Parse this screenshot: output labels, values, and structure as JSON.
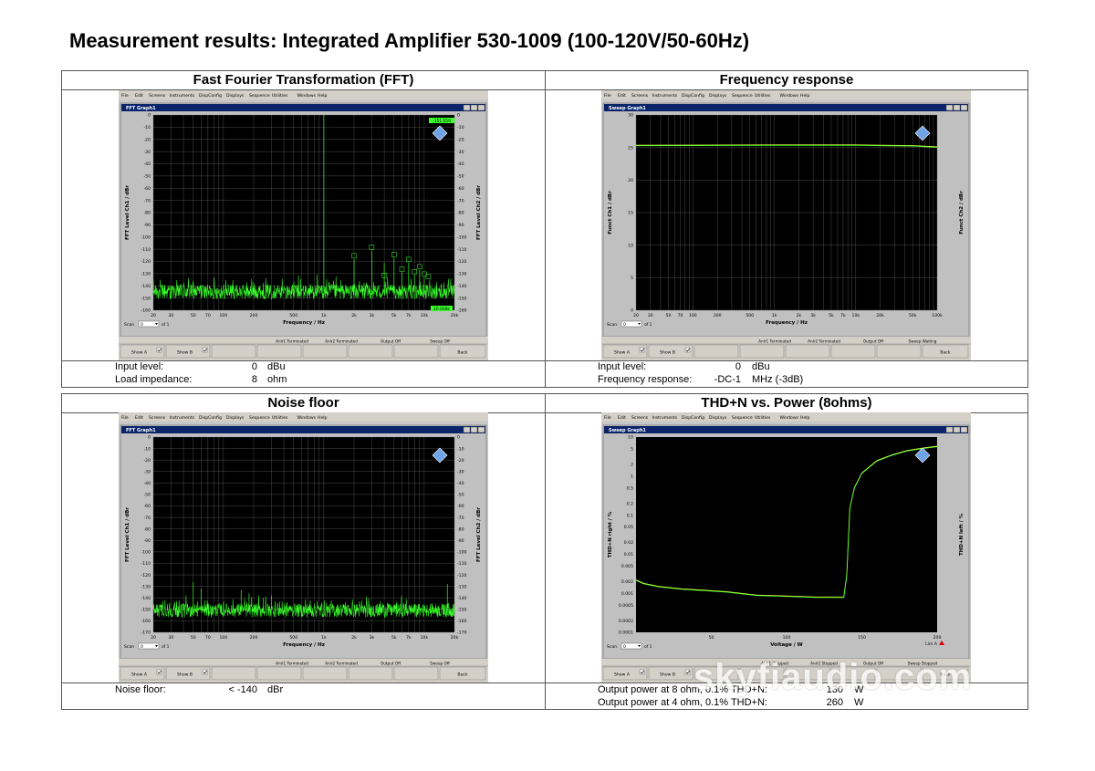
{
  "page": {
    "title": "Measurement results: Integrated Amplifier 530-1009 (100-120V/50-60Hz)",
    "watermark": "skyfiaudio.com"
  },
  "menu": [
    "File",
    "Edit",
    "Screens",
    "Instruments",
    "DispConfig",
    "Displays",
    "Sequence",
    "Utilities",
    "Windows",
    "Help"
  ],
  "common": {
    "scan_label": "Scan",
    "scan_value": "0",
    "scan_of": "of 1",
    "show_a": "Show A",
    "show_b": "Show B",
    "back": "Back"
  },
  "fft": {
    "heading": "Fast Fourier Transformation (FFT)",
    "window_title": "FFT Graph1",
    "status": [
      "Anlr1 Terminated",
      "Anlr2 Terminated",
      "Output Off",
      "Sweep Off"
    ],
    "marker_top": "-151.059",
    "marker_bottom": "20.000k",
    "info": [
      {
        "label": "Input level:",
        "value": "0",
        "unit": "dBu"
      },
      {
        "label": "Load impedance:",
        "value": "8",
        "unit": "ohm"
      }
    ]
  },
  "freq": {
    "heading": "Frequency response",
    "window_title": "Sweep Graph1",
    "status": [
      "Anlr1 Terminated",
      "Anlr2 Terminated",
      "Output Off",
      "Sweep Waiting"
    ],
    "info": [
      {
        "label": "Input level:",
        "value": "0",
        "unit": "dBu"
      },
      {
        "label": "Frequency response:",
        "value": "-DC-1",
        "unit": "MHz (-3dB)"
      }
    ]
  },
  "noise": {
    "heading": "Noise floor",
    "window_title": "FFT Graph1",
    "status": [
      "Anlr1 Terminated",
      "Anlr2 Terminated",
      "Output Off",
      "Sweep Off"
    ],
    "info": [
      {
        "label": "Noise floor:",
        "value": "< -140",
        "unit": "dBr"
      }
    ]
  },
  "thd": {
    "heading": "THD+N vs. Power (8ohms)",
    "window_title": "Sweep Graph1",
    "status": [
      "Anlr1 Stopped",
      "Anlr2 Stopped",
      "Output Off",
      "Sweep Stopped"
    ],
    "lim_label": "Lim A",
    "info": [
      {
        "label": "Output power at 8 ohm, 0.1% THD+N:",
        "value": "130",
        "unit": "W"
      },
      {
        "label": "Output power at 4 ohm, 0.1% THD+N:",
        "value": "260",
        "unit": "W"
      }
    ]
  },
  "chart_data": [
    {
      "type": "line",
      "id": "fft",
      "xscale": "log",
      "xlim": [
        20,
        20000
      ],
      "ylim": [
        -160,
        0
      ],
      "xlabel": "Frequency / Hz",
      "ylabel": "FFT Level Ch1 / dBr",
      "ylabel2": "FFT Level Ch2 / dBr",
      "xticks": [
        20,
        30,
        50,
        70,
        100,
        200,
        500,
        1000,
        2000,
        3000,
        5000,
        7000,
        10000,
        20000
      ],
      "xtick_labels": [
        "20",
        "30",
        "50",
        "70",
        "100",
        "200",
        "500",
        "1k",
        "2k",
        "3k",
        "5k",
        "7k",
        "10k",
        "20k"
      ],
      "yticks": [
        0,
        -10,
        -20,
        -30,
        -40,
        -50,
        -60,
        -70,
        -80,
        -90,
        -100,
        -110,
        -120,
        -130,
        -140,
        -150,
        -160
      ],
      "ytick_labels": [
        "0",
        "-10",
        "-20",
        "-30",
        "-40",
        "-50",
        "-60",
        "-70",
        "-80",
        "-90",
        "-100",
        "-110",
        "-120",
        "-130",
        "-140",
        "-150",
        "-160"
      ],
      "grid": true,
      "noise": {
        "y": -145,
        "spread": 6
      },
      "peaks": [
        {
          "x": 1000,
          "y": 0
        },
        {
          "x": 50,
          "y": -138
        },
        {
          "x": 60,
          "y": -140
        },
        {
          "x": 200,
          "y": -137
        },
        {
          "x": 500,
          "y": -139
        },
        {
          "x": 2000,
          "y": -118
        },
        {
          "x": 3000,
          "y": -111
        },
        {
          "x": 4000,
          "y": -121
        },
        {
          "x": 5000,
          "y": -117
        },
        {
          "x": 6000,
          "y": -129
        },
        {
          "x": 7000,
          "y": -121
        },
        {
          "x": 8000,
          "y": -131
        },
        {
          "x": 9000,
          "y": -127
        },
        {
          "x": 10000,
          "y": -133
        }
      ],
      "markers": [
        {
          "x": 2000,
          "y": -118
        },
        {
          "x": 3000,
          "y": -111
        },
        {
          "x": 4000,
          "y": -134
        },
        {
          "x": 5000,
          "y": -117
        },
        {
          "x": 6000,
          "y": -129
        },
        {
          "x": 7000,
          "y": -121
        },
        {
          "x": 8000,
          "y": -131
        },
        {
          "x": 9000,
          "y": -127
        },
        {
          "x": 10000,
          "y": -133
        },
        {
          "x": 11000,
          "y": -135
        }
      ]
    },
    {
      "type": "line",
      "id": "freq",
      "xscale": "log",
      "xlim": [
        20,
        100000
      ],
      "ylim": [
        0,
        30
      ],
      "xlabel": "Frequency / Hz",
      "ylabel": "Funct Ch1 / dBr",
      "ylabel2": "Funct Ch2 / dBr",
      "xticks": [
        20,
        30,
        50,
        70,
        100,
        200,
        500,
        1000,
        2000,
        3000,
        5000,
        7000,
        10000,
        20000,
        50000,
        100000
      ],
      "xtick_labels": [
        "20",
        "30",
        "50",
        "70",
        "100",
        "200",
        "500",
        "1k",
        "2k",
        "3k",
        "5k",
        "7k",
        "10k",
        "20k",
        "50k",
        "100k"
      ],
      "yticks": [
        0,
        5,
        10,
        15,
        20,
        25,
        30
      ],
      "ytick_labels": [
        "0",
        "5",
        "10",
        "15",
        "20",
        "25",
        "30"
      ],
      "grid": true,
      "series": [
        {
          "x": [
            20,
            1000,
            10000,
            20000,
            50000,
            100000
          ],
          "y": [
            25.35,
            25.4,
            25.4,
            25.35,
            25.3,
            25.1
          ]
        }
      ]
    },
    {
      "type": "line",
      "id": "noise",
      "xscale": "log",
      "xlim": [
        20,
        20000
      ],
      "ylim": [
        -170,
        0
      ],
      "xlabel": "Frequency / Hz",
      "ylabel": "FFT Level Ch1 / dBr",
      "ylabel2": "FFT Level Ch2 / dBr",
      "xticks": [
        20,
        30,
        50,
        70,
        100,
        200,
        500,
        1000,
        2000,
        3000,
        5000,
        7000,
        10000,
        20000
      ],
      "xtick_labels": [
        "20",
        "30",
        "50",
        "70",
        "100",
        "200",
        "500",
        "1k",
        "2k",
        "3k",
        "5k",
        "7k",
        "10k",
        "20k"
      ],
      "yticks": [
        0,
        -10,
        -20,
        -30,
        -40,
        -50,
        -60,
        -70,
        -80,
        -90,
        -100,
        -110,
        -120,
        -130,
        -140,
        -150,
        -160,
        -170
      ],
      "ytick_labels": [
        "0",
        "-10",
        "-20",
        "-30",
        "-40",
        "-50",
        "-60",
        "-70",
        "-80",
        "-90",
        "-100",
        "-110",
        "-120",
        "-130",
        "-140",
        "-150",
        "-160",
        "-170"
      ],
      "grid": true,
      "noise": {
        "y": -151,
        "spread": 6
      },
      "peaks": [
        {
          "x": 50,
          "y": -126
        },
        {
          "x": 60,
          "y": -132
        },
        {
          "x": 150,
          "y": -133
        },
        {
          "x": 180,
          "y": -136
        },
        {
          "x": 250,
          "y": -140
        },
        {
          "x": 300,
          "y": -138
        },
        {
          "x": 17000,
          "y": -128
        }
      ]
    },
    {
      "type": "line",
      "id": "thd",
      "xscale": "linear",
      "yscale": "log",
      "xlim": [
        0,
        200
      ],
      "ylim": [
        0.0001,
        10
      ],
      "xlabel": "Voltage / W",
      "ylabel": "THD+N right / %",
      "ylabel2": "THD+N left / %",
      "xticks": [
        50,
        100,
        150,
        200
      ],
      "xtick_labels": [
        "50",
        "100",
        "150",
        "200"
      ],
      "yticks": [
        10,
        5,
        2,
        1,
        0.5,
        0.2,
        0.1,
        0.05,
        0.02,
        0.01,
        0.005,
        0.002,
        0.001,
        0.0005,
        0.0002,
        0.0001
      ],
      "ytick_labels": [
        "10",
        "5",
        "2",
        "1",
        "0.5",
        "0.2",
        "0.1",
        "0.05",
        "0.02",
        "0.01",
        "0.005",
        "0.002",
        "0.001",
        "0.0005",
        "0.0002",
        "0.0001"
      ],
      "grid": false,
      "series": [
        {
          "x": [
            0,
            5,
            15,
            30,
            45,
            60,
            80,
            100,
            120,
            135,
            138,
            140,
            142,
            145,
            150,
            160,
            170,
            180,
            190,
            200
          ],
          "y": [
            0.0022,
            0.0018,
            0.0015,
            0.0013,
            0.0012,
            0.0011,
            0.0009,
            0.00085,
            0.0008,
            0.0008,
            0.0008,
            0.003,
            0.15,
            0.5,
            1.2,
            2.5,
            3.5,
            4.5,
            5.2,
            5.8
          ]
        }
      ]
    }
  ]
}
